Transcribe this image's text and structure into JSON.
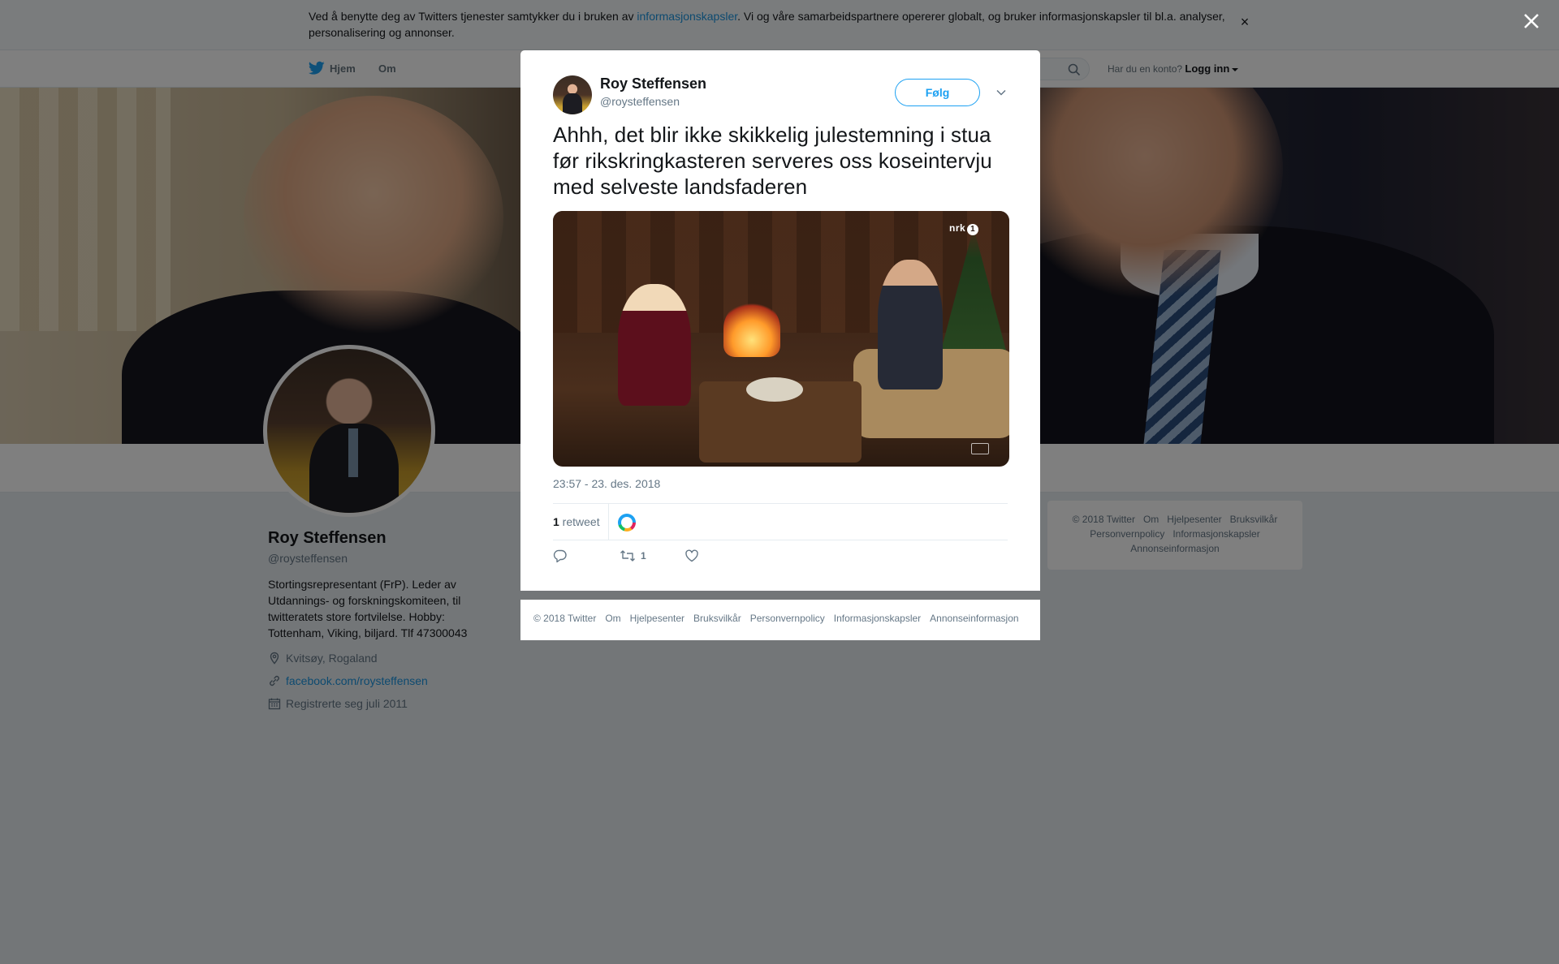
{
  "cookie_banner": {
    "text_before": "Ved å benytte deg av Twitters tjenester samtykker du i bruken av ",
    "link": "informasjonskapsler",
    "text_after": ". Vi og våre samarbeidspartnere opererer globalt, og bruker informasjonskapsler til bl.a. analyser, personalisering og annonser.",
    "close": "×"
  },
  "nav": {
    "home": "Hjem",
    "about": "Om",
    "account_prompt": "Har du en konto?",
    "login": "Logg inn"
  },
  "profile": {
    "name": "Roy Steffensen",
    "handle": "@roysteffensen",
    "bio": "Stortingsrepresentant (FrP). Leder av Utdannings- og forskningskomiteen, til twitteratets store fortvilelse. Hobby: Tottenham, Viking, biljard. Tlf 47300043",
    "location": "Kvitsøy, Rogaland",
    "website": "facebook.com/roysteffensen",
    "joined": "Registrerte seg juli 2011"
  },
  "sidebar_footer": {
    "items": [
      "© 2018 Twitter",
      "Om",
      "Hjelpesenter",
      "Bruksvilkår",
      "Personvernpolicy",
      "Informasjonskapsler",
      "Annonseinformasjon"
    ]
  },
  "tweet": {
    "author_name": "Roy Steffensen",
    "author_handle": "@roysteffensen",
    "follow_label": "Følg",
    "text": "Ahhh, det blir ikke skikkelig julestemning i stua før rikskringkasteren serveres oss koseintervju med selveste landsfaderen",
    "media_logo": "nrk",
    "media_logo_num": "1",
    "timestamp": "23:57 - 23. des. 2018",
    "retweet_count": "1",
    "retweet_label": " retweet",
    "action_retweet_count": "1"
  },
  "modal_footer": {
    "items": [
      "© 2018 Twitter",
      "Om",
      "Hjelpesenter",
      "Bruksvilkår",
      "Personvernpolicy",
      "Informasjonskapsler",
      "Annonseinformasjon"
    ]
  },
  "colors": {
    "accent": "#1da1f2",
    "link": "#1b95e0",
    "overlay": "rgba(0,0,0,0.5)"
  }
}
